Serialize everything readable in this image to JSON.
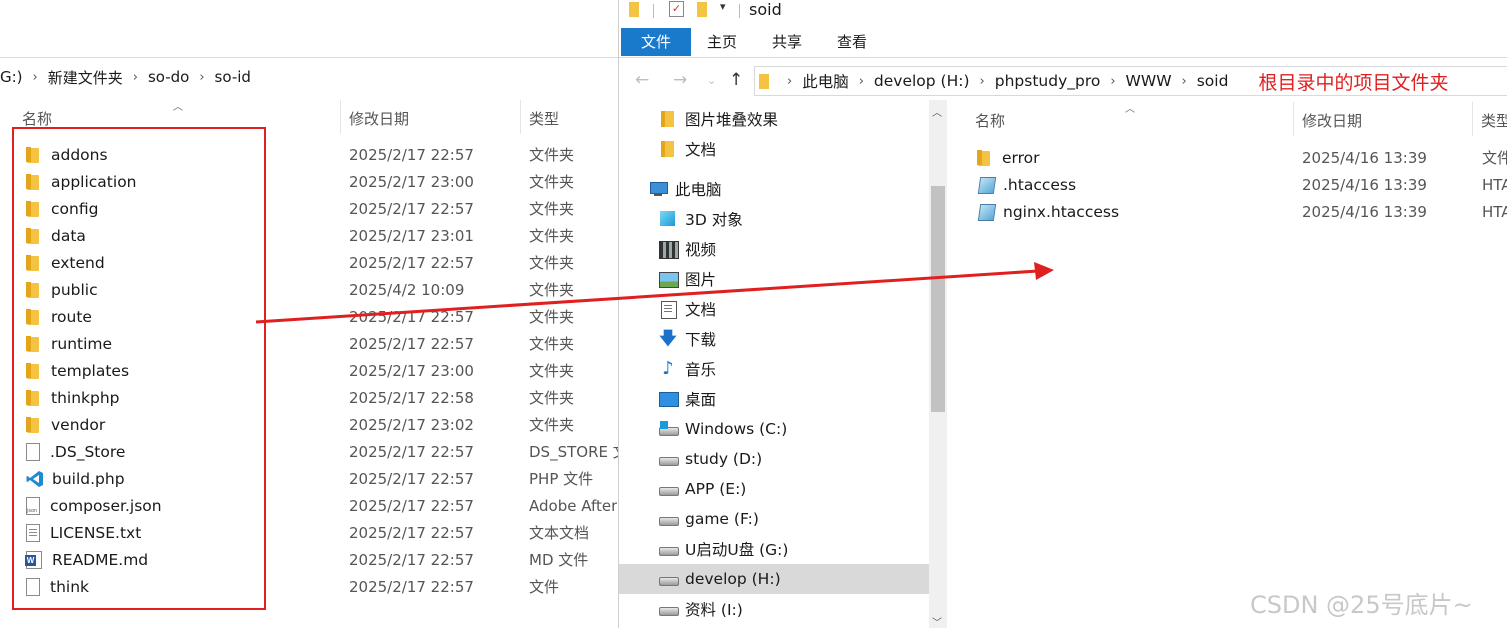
{
  "left": {
    "breadcrumb": [
      "G:)",
      "新建文件夹",
      "so-do",
      "so-id"
    ],
    "columns": {
      "name": "名称",
      "date": "修改日期",
      "type": "类型"
    },
    "files": [
      {
        "name": "addons",
        "date": "2025/2/17 22:57",
        "type": "文件夹",
        "icon": "folder-icon"
      },
      {
        "name": "application",
        "date": "2025/2/17 23:00",
        "type": "文件夹",
        "icon": "folder-icon"
      },
      {
        "name": "config",
        "date": "2025/2/17 22:57",
        "type": "文件夹",
        "icon": "folder-icon"
      },
      {
        "name": "data",
        "date": "2025/2/17 23:01",
        "type": "文件夹",
        "icon": "folder-icon"
      },
      {
        "name": "extend",
        "date": "2025/2/17 22:57",
        "type": "文件夹",
        "icon": "folder-icon"
      },
      {
        "name": "public",
        "date": "2025/4/2 10:09",
        "type": "文件夹",
        "icon": "folder-icon"
      },
      {
        "name": "route",
        "date": "2025/2/17 22:57",
        "type": "文件夹",
        "icon": "folder-icon"
      },
      {
        "name": "runtime",
        "date": "2025/2/17 22:57",
        "type": "文件夹",
        "icon": "folder-icon"
      },
      {
        "name": "templates",
        "date": "2025/2/17 23:00",
        "type": "文件夹",
        "icon": "folder-icon"
      },
      {
        "name": "thinkphp",
        "date": "2025/2/17 22:58",
        "type": "文件夹",
        "icon": "folder-icon"
      },
      {
        "name": "vendor",
        "date": "2025/2/17 23:02",
        "type": "文件夹",
        "icon": "folder-icon"
      },
      {
        "name": ".DS_Store",
        "date": "2025/2/17 22:57",
        "type": "DS_STORE 文",
        "icon": "file-icon"
      },
      {
        "name": "build.php",
        "date": "2025/2/17 22:57",
        "type": "PHP 文件",
        "icon": "vscode-icon"
      },
      {
        "name": "composer.json",
        "date": "2025/2/17 22:57",
        "type": "Adobe After",
        "icon": "json-file-icon"
      },
      {
        "name": "LICENSE.txt",
        "date": "2025/2/17 22:57",
        "type": "文本文档",
        "icon": "text-file-icon"
      },
      {
        "name": "README.md",
        "date": "2025/2/17 22:57",
        "type": "MD 文件",
        "icon": "word-icon"
      },
      {
        "name": "think",
        "date": "2025/2/17 22:57",
        "type": "文件",
        "icon": "file-icon"
      }
    ]
  },
  "right": {
    "window_title": "soid",
    "ribbon_tabs": [
      "文件",
      "主页",
      "共享",
      "查看"
    ],
    "breadcrumb": [
      "此电脑",
      "develop (H:)",
      "phpstudy_pro",
      "WWW",
      "soid"
    ],
    "annotation": "根目录中的项目文件夹",
    "nav": [
      {
        "label": "图片堆叠效果",
        "icon": "folder-icon",
        "indent": 1
      },
      {
        "label": "文档",
        "icon": "folder-icon",
        "indent": 1
      },
      {
        "label": "此电脑",
        "icon": "computer-icon",
        "indent": 0
      },
      {
        "label": "3D 对象",
        "icon": "3d-objects-icon",
        "indent": 1
      },
      {
        "label": "视频",
        "icon": "video-icon",
        "indent": 1
      },
      {
        "label": "图片",
        "icon": "pictures-icon",
        "indent": 1
      },
      {
        "label": "文档",
        "icon": "documents-icon",
        "indent": 1
      },
      {
        "label": "下载",
        "icon": "download-icon",
        "indent": 1
      },
      {
        "label": "音乐",
        "icon": "music-icon",
        "indent": 1
      },
      {
        "label": "桌面",
        "icon": "desktop-icon",
        "indent": 1
      },
      {
        "label": "Windows (C:)",
        "icon": "windows-drive-icon",
        "indent": 1
      },
      {
        "label": "study (D:)",
        "icon": "drive-icon",
        "indent": 1
      },
      {
        "label": "APP (E:)",
        "icon": "drive-icon",
        "indent": 1
      },
      {
        "label": "game (F:)",
        "icon": "drive-icon",
        "indent": 1
      },
      {
        "label": "U启动U盘 (G:)",
        "icon": "drive-icon",
        "indent": 1
      },
      {
        "label": "develop (H:)",
        "icon": "drive-icon",
        "indent": 1,
        "selected": true
      },
      {
        "label": "资料 (I:)",
        "icon": "drive-icon",
        "indent": 1
      }
    ],
    "columns": {
      "name": "名称",
      "date": "修改日期",
      "type": "类型"
    },
    "files": [
      {
        "name": "error",
        "date": "2025/4/16 13:39",
        "type": "文件",
        "icon": "folder-icon"
      },
      {
        "name": ".htaccess",
        "date": "2025/4/16 13:39",
        "type": "HTA",
        "icon": "htaccess-icon"
      },
      {
        "name": "nginx.htaccess",
        "date": "2025/4/16 13:39",
        "type": "HTA",
        "icon": "htaccess-icon"
      }
    ]
  },
  "watermark": "CSDN @25号底片~",
  "colors": {
    "highlight_red": "#e02020",
    "ribbon_file_tab": "#1979ca",
    "selected_nav": "#d9d9d9"
  }
}
